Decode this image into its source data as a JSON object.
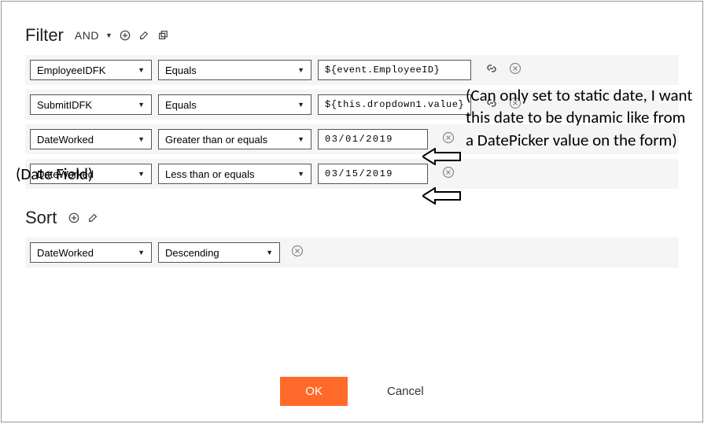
{
  "filter": {
    "title": "Filter",
    "operator": "AND",
    "rows": [
      {
        "field": "EmployeeIDFK",
        "op": "Equals",
        "value": "${event.EmployeeID}",
        "value_type": "text"
      },
      {
        "field": "SubmitIDFK",
        "op": "Equals",
        "value": "${this.dropdown1.value}",
        "value_type": "text"
      },
      {
        "field": "DateWorked",
        "op": "Greater than or equals",
        "value": "03/01/2019",
        "value_type": "date"
      },
      {
        "field": "DateWorked",
        "op": "Less than or equals",
        "value": "03/15/2019",
        "value_type": "date"
      }
    ]
  },
  "sort": {
    "title": "Sort",
    "rows": [
      {
        "field": "DateWorked",
        "direction": "Descending"
      }
    ]
  },
  "buttons": {
    "ok": "OK",
    "cancel": "Cancel"
  },
  "annotations": {
    "date_field": "(Date Field)",
    "static_date": "(Can only set to static date, I want this date to be dynamic like from a DatePicker value on the form)"
  }
}
